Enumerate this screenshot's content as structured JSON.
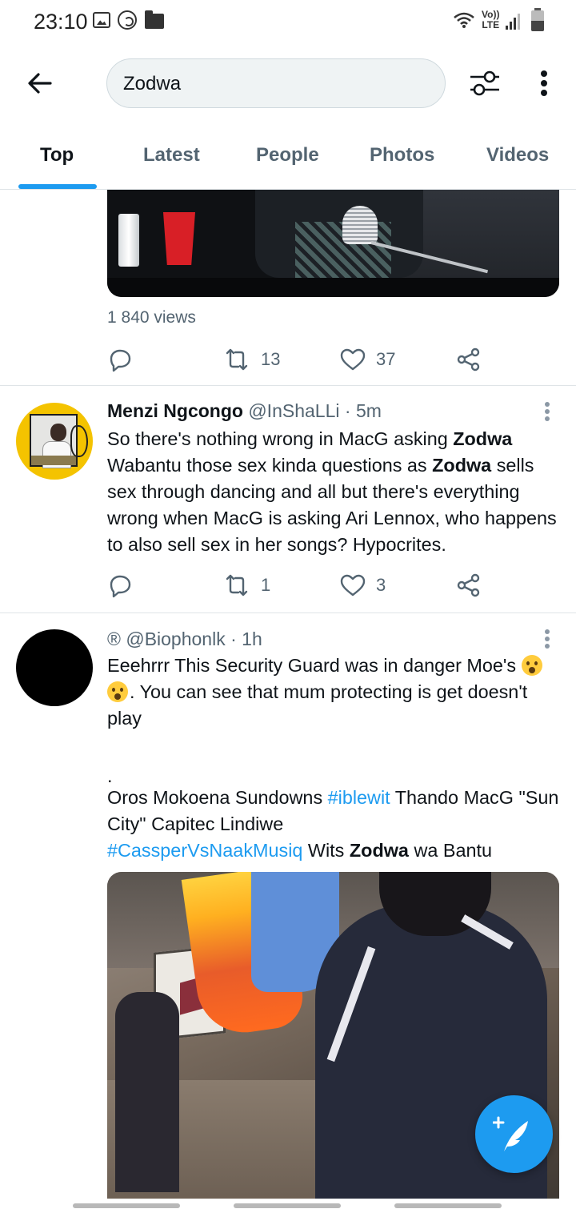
{
  "status_bar": {
    "time": "23:10",
    "network_label_top": "Vo))",
    "network_label_bottom": "LTE",
    "icons": [
      "image-icon",
      "whatsapp-icon",
      "folder-icon",
      "wifi-icon",
      "signal-icon",
      "battery-icon"
    ]
  },
  "search": {
    "query": "Zodwa"
  },
  "tabs": [
    {
      "label": "Top",
      "active": true
    },
    {
      "label": "Latest",
      "active": false
    },
    {
      "label": "People",
      "active": false
    },
    {
      "label": "Photos",
      "active": false
    },
    {
      "label": "Videos",
      "active": false
    }
  ],
  "tweet0": {
    "views": "1 840 views",
    "retweets": "13",
    "likes": "37"
  },
  "tweet1": {
    "name": "Menzi Ngcongo",
    "handle": "@InShaLLi",
    "sep": "·",
    "time": "5m",
    "text": {
      "p1": "So there's nothing wrong in MacG asking ",
      "hl1": "Zodwa",
      "p2": " Wabantu those sex kinda questions as ",
      "hl2": "Zodwa",
      "p3": " sells sex through dancing and all but there's everything wrong when MacG is asking Ari Lennox, who happens to also sell sex in her songs? Hypocrites."
    },
    "replies": "",
    "retweets": "1",
    "likes": "3"
  },
  "tweet2": {
    "name": "®",
    "handle": "@Biophonlk",
    "sep": "·",
    "time": "1h",
    "text": {
      "p1": "Eeehrrr This Security Guard was in danger Moe's ",
      "p2": ".  You can see that mum protecting is get doesn't play",
      "dot": ".",
      "p3": "Oros Mokoena Sundowns ",
      "tag1": "#iblewit",
      "p4": " Thando MacG \"Sun City\" Capitec Lindiwe ",
      "tag2": "#CassperVsNaakMusiq",
      "p5": "  Wits ",
      "hl1": "Zodwa",
      "p6": " wa Bantu"
    }
  },
  "colors": {
    "accent": "#1d9bf0",
    "text_primary": "#0f1419",
    "text_secondary": "#536471",
    "divider": "#dfe4e7"
  }
}
